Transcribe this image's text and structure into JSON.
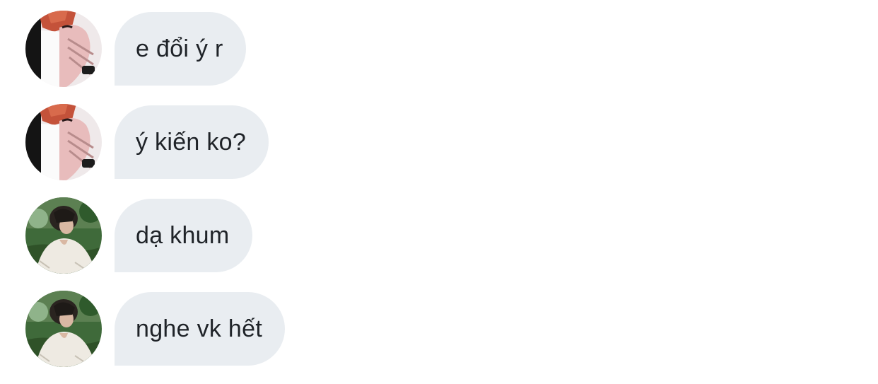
{
  "messages": [
    {
      "sender_avatar": "avatar-red-hair",
      "text": "e đổi ý r"
    },
    {
      "sender_avatar": "avatar-red-hair",
      "text": "ý kiến ko?"
    },
    {
      "sender_avatar": "avatar-garden",
      "text": "dạ khum"
    },
    {
      "sender_avatar": "avatar-garden",
      "text": "nghe vk hết"
    }
  ],
  "colors": {
    "bubble_background": "#e9edf1",
    "text": "#1f2328",
    "page_background": "#ffffff"
  }
}
